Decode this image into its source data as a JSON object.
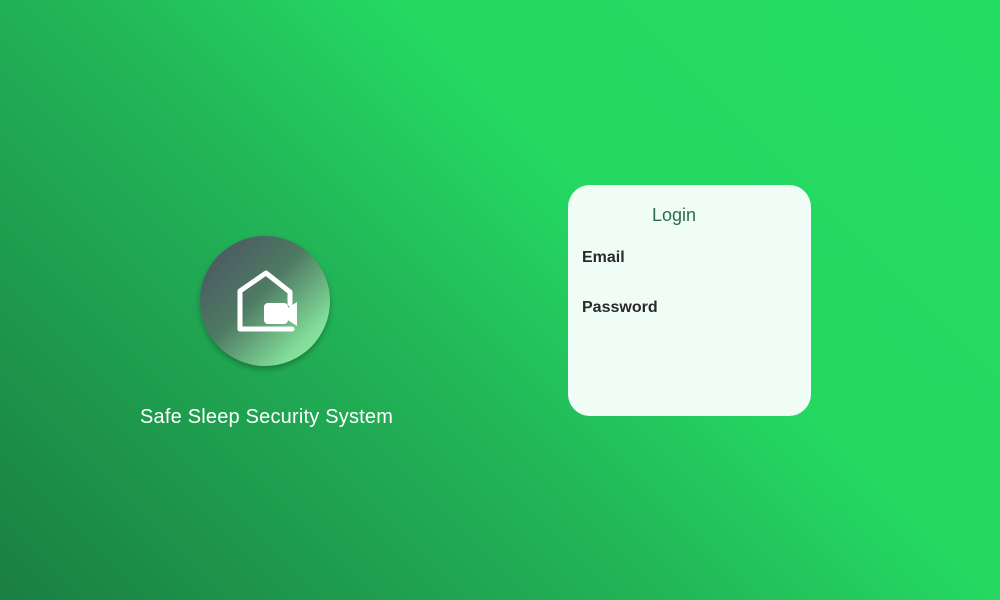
{
  "brand": {
    "app_title": "Safe Sleep Security System",
    "logo_icon": "home-camera-icon"
  },
  "login": {
    "title": "Login",
    "email_label": "Email",
    "email_value": "",
    "password_label": "Password",
    "password_value": ""
  },
  "colors": {
    "background_start": "#1a7f42",
    "background_end": "#23dc64",
    "card_background": "#effdf6",
    "login_title": "#2e6b4a",
    "label_text": "#2a2a2a"
  }
}
